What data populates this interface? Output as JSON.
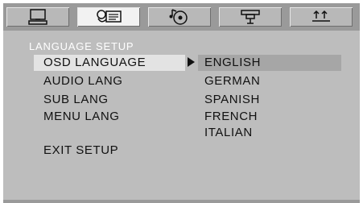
{
  "tabs": [
    {
      "icon": "monitor-icon",
      "active": false
    },
    {
      "icon": "language-icon",
      "active": true
    },
    {
      "icon": "audio-disc-icon",
      "active": false
    },
    {
      "icon": "video-camera-icon",
      "active": false
    },
    {
      "icon": "preference-icon",
      "active": false
    }
  ],
  "section_title": "LANGUAGE SETUP",
  "menu": [
    {
      "label": "OSD LANGUAGE",
      "selected": true
    },
    {
      "label": "AUDIO LANG",
      "selected": false
    },
    {
      "label": "SUB LANG",
      "selected": false
    },
    {
      "label": "MENU LANG",
      "selected": false
    },
    {
      "label": "EXIT SETUP",
      "selected": false
    }
  ],
  "options": [
    "ENGLISH",
    "GERMAN",
    "SPANISH",
    "FRENCH",
    "ITALIAN"
  ],
  "selected_option": "ENGLISH"
}
